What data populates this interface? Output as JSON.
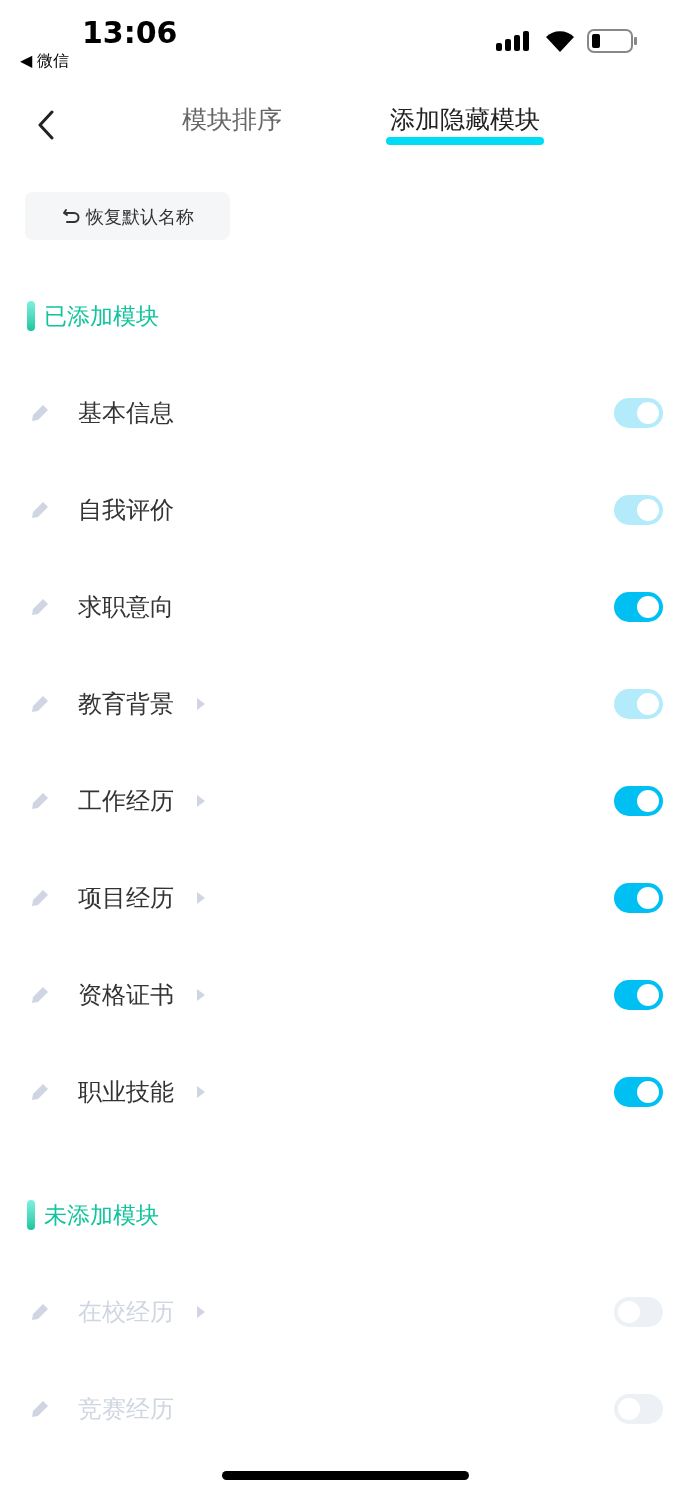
{
  "status_bar": {
    "time": "13:06",
    "back_app": "◀ 微信"
  },
  "header": {
    "tabs": [
      {
        "label": "模块排序",
        "selected": false
      },
      {
        "label": "添加隐藏模块",
        "selected": true
      }
    ]
  },
  "reset_button": {
    "label": "恢复默认名称"
  },
  "sections": [
    {
      "title": "已添加模块",
      "rows": [
        {
          "label": "基本信息",
          "arrow": false,
          "on": true,
          "disabled": true
        },
        {
          "label": "自我评价",
          "arrow": false,
          "on": true,
          "disabled": true
        },
        {
          "label": "求职意向",
          "arrow": false,
          "on": true,
          "disabled": false
        },
        {
          "label": "教育背景",
          "arrow": true,
          "on": true,
          "disabled": true
        },
        {
          "label": "工作经历",
          "arrow": true,
          "on": true,
          "disabled": false
        },
        {
          "label": "项目经历",
          "arrow": true,
          "on": true,
          "disabled": false
        },
        {
          "label": "资格证书",
          "arrow": true,
          "on": true,
          "disabled": false
        },
        {
          "label": "职业技能",
          "arrow": true,
          "on": true,
          "disabled": false
        }
      ]
    },
    {
      "title": "未添加模块",
      "rows": [
        {
          "label": "在校经历",
          "arrow": true,
          "on": false,
          "disabled": true
        },
        {
          "label": "竞赛经历",
          "arrow": false,
          "on": false,
          "disabled": true
        }
      ]
    }
  ]
}
